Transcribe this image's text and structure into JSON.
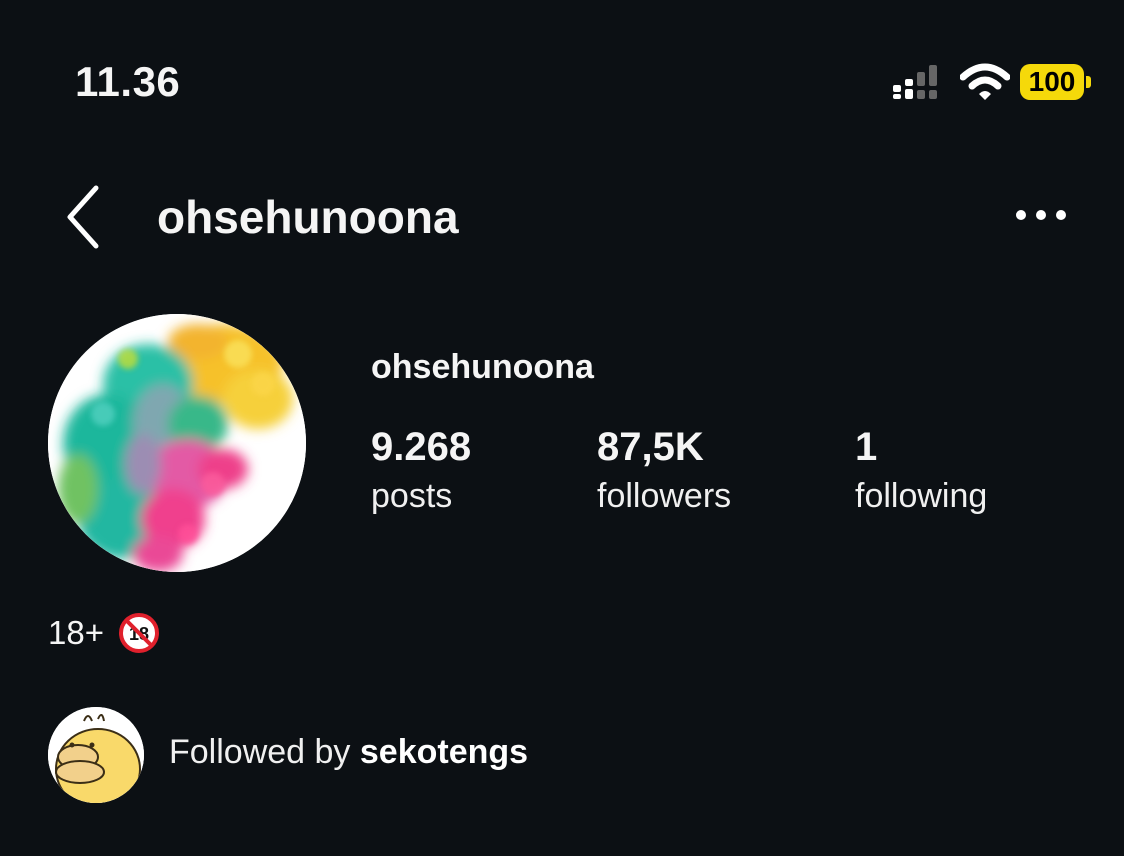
{
  "status_bar": {
    "time": "11.36",
    "battery_level": "100",
    "battery_color": "#f5d90a",
    "icons": [
      "signal-icon",
      "wifi-icon",
      "battery-icon"
    ]
  },
  "header": {
    "title": "ohsehunoona",
    "back_icon": "chevron-left-icon",
    "more_icon": "more-horizontal-icon"
  },
  "profile": {
    "name": "ohsehunoona",
    "stats": [
      {
        "value": "9.268",
        "label": "posts"
      },
      {
        "value": "87,5K",
        "label": "followers"
      },
      {
        "value": "1",
        "label": "following"
      }
    ],
    "bio": "18+",
    "bio_icon": "no-under-18-icon"
  },
  "followed_by": {
    "prefix": "Followed by",
    "user": "sekotengs"
  },
  "colors": {
    "background": "#0c1014",
    "text": "#f5f5f5"
  }
}
